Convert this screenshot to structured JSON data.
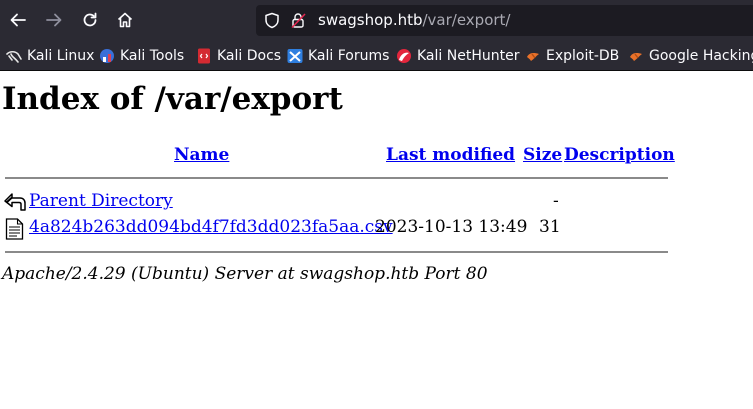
{
  "browser": {
    "url_host": "swagshop.htb",
    "url_path": "/var/export/",
    "bookmarks": [
      {
        "label": "Kali Linux",
        "icon": "kali-dragon-icon"
      },
      {
        "label": "Kali Tools",
        "icon": "kali-tools-icon"
      },
      {
        "label": "Kali Docs",
        "icon": "kali-docs-icon"
      },
      {
        "label": "Kali Forums",
        "icon": "kali-forums-icon"
      },
      {
        "label": "Kali NetHunter",
        "icon": "kali-nethunter-icon"
      },
      {
        "label": "Exploit-DB",
        "icon": "exploit-db-icon"
      },
      {
        "label": "Google Hacking",
        "icon": "google-hacking-icon"
      }
    ]
  },
  "page": {
    "title": "Index of /var/export",
    "columns": {
      "name": "Name",
      "last_modified": "Last modified",
      "size": "Size",
      "description": "Description"
    },
    "rows": [
      {
        "name": "Parent Directory",
        "last_modified": "",
        "size": "-",
        "description": "",
        "icon": "parent-directory-icon"
      },
      {
        "name": "4a824b263dd094bd4f7fd3dd023fa5aa.csv",
        "last_modified": "2023-10-13 13:49",
        "size": "31",
        "description": "",
        "icon": "text-file-icon"
      }
    ],
    "footer": "Apache/2.4.29 (Ubuntu) Server at swagshop.htb Port 80"
  }
}
